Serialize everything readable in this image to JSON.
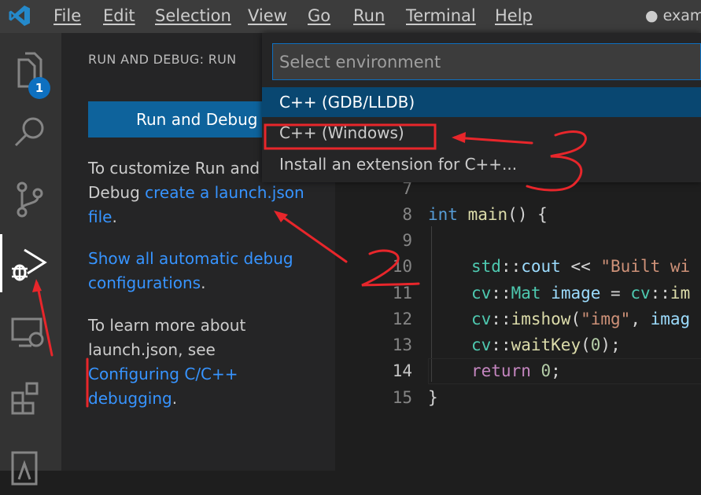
{
  "titlebar": {
    "menus": [
      {
        "label": "File"
      },
      {
        "label": "Edit"
      },
      {
        "label": "Selection"
      },
      {
        "label": "View"
      },
      {
        "label": "Go"
      },
      {
        "label": "Run"
      },
      {
        "label": "Terminal"
      },
      {
        "label": "Help"
      }
    ],
    "title": "● examp"
  },
  "activitybar": {
    "explorer_badge": "1",
    "items": [
      {
        "icon": "files-icon"
      },
      {
        "icon": "search-icon"
      },
      {
        "icon": "source-control-icon"
      },
      {
        "icon": "run-debug-icon"
      },
      {
        "icon": "remote-explorer-icon"
      },
      {
        "icon": "extensions-icon"
      },
      {
        "icon": "testing-icon"
      }
    ]
  },
  "sidebar": {
    "title": "RUN AND DEBUG: RUN",
    "run_button": "Run and Debug",
    "para1_text": "To customize Run and Debug ",
    "para1_link": "create a launch.json file",
    "para1_end": ".",
    "para2_link": "Show all automatic debug configurations",
    "para2_end": ".",
    "para3_text": "To learn more about launch.json, see ",
    "para3_link": "Configuring C/C++ debugging",
    "para3_end": "."
  },
  "quickpick": {
    "placeholder": "Select environment",
    "items": [
      {
        "label": "C++ (GDB/LLDB)"
      },
      {
        "label": "C++ (Windows)"
      },
      {
        "label": "Install an extension for C++..."
      }
    ]
  },
  "editor": {
    "lines": [
      {
        "number": "7"
      },
      {
        "number": "8"
      },
      {
        "number": "9"
      },
      {
        "number": "10"
      },
      {
        "number": "11"
      },
      {
        "number": "12"
      },
      {
        "number": "13"
      },
      {
        "number": "14"
      },
      {
        "number": "15"
      }
    ],
    "code": {
      "l8_kw": "int",
      "l8_fn": "main",
      "l8_rest": "() {",
      "l10_ns": "std",
      "l10_sep": "::",
      "l10_var": "cout",
      "l10_op": " << ",
      "l10_str": "\"Built wi",
      "l11_ns": "cv",
      "l11_sep": "::",
      "l11_type": "Mat",
      "l11_var": " image",
      "l11_op": " = ",
      "l11_ns2": "cv",
      "l11_sep2": "::",
      "l11_fn": "im",
      "l12_ns": "cv",
      "l12_sep": "::",
      "l12_fn": "imshow",
      "l12_p": "(",
      "l12_str": "\"img\"",
      "l12_c": ", ",
      "l12_var": "imag",
      "l13_ns": "cv",
      "l13_sep": "::",
      "l13_fn": "waitKey",
      "l13_p": "(",
      "l13_num": "0",
      "l13_end": ");",
      "l14_kw": "return",
      "l14_num": " 0",
      "l14_end": ";",
      "l15": "}"
    }
  },
  "colors": {
    "accent": "#0e639c",
    "selection": "#094771",
    "annotation": "#e8262b"
  }
}
